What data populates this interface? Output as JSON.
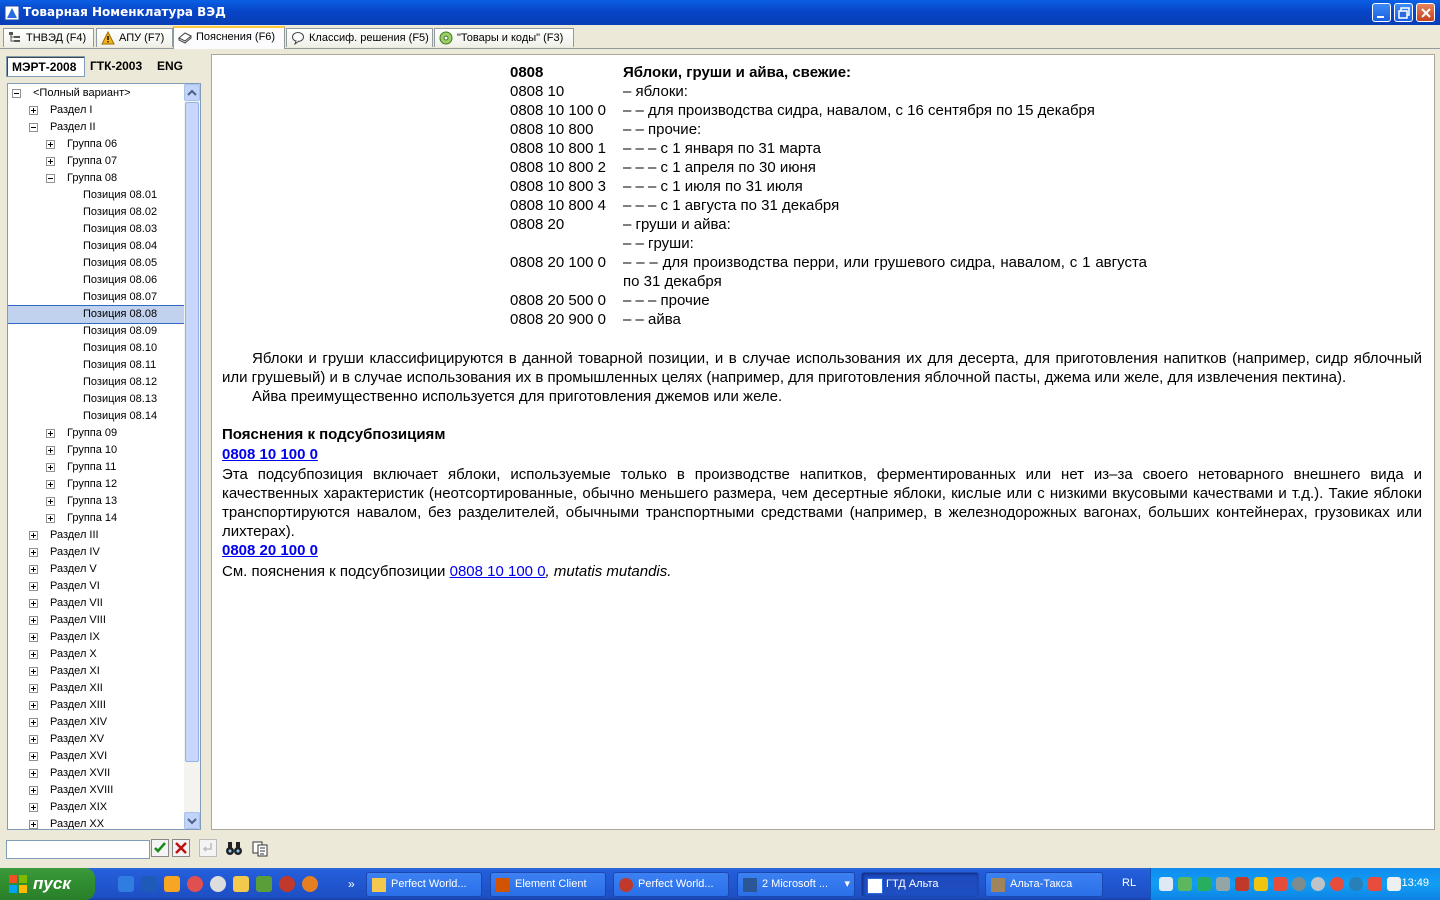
{
  "window": {
    "title": "Товарная Номенклатура ВЭД"
  },
  "tabs": [
    {
      "label": "ТНВЭД (F4)"
    },
    {
      "label": "АПУ (F7)"
    },
    {
      "label": "Пояснения (F6)"
    },
    {
      "label": "Классиф. решения (F5)"
    },
    {
      "label": "\"Товары и коды\" (F3)"
    }
  ],
  "lang_buttons": [
    "МЭРТ-2008",
    "ГТК-2003",
    "ENG"
  ],
  "tree": {
    "items": [
      "<Полный вариант>",
      "Раздел I",
      "Раздел II",
      "Группа 06",
      "Группа 07",
      "Группа 08",
      "Позиция 08.01",
      "Позиция 08.02",
      "Позиция 08.03",
      "Позиция 08.04",
      "Позиция 08.05",
      "Позиция 08.06",
      "Позиция 08.07",
      "Позиция 08.08",
      "Позиция 08.09",
      "Позиция 08.10",
      "Позиция 08.11",
      "Позиция 08.12",
      "Позиция 08.13",
      "Позиция 08.14",
      "Группа 09",
      "Группа 10",
      "Группа 11",
      "Группа 12",
      "Группа 13",
      "Группа 14",
      "Раздел III",
      "Раздел IV",
      "Раздел V",
      "Раздел VI",
      "Раздел VII",
      "Раздел VIII",
      "Раздел IX",
      "Раздел X",
      "Раздел XI",
      "Раздел XII",
      "Раздел XIII",
      "Раздел XIV",
      "Раздел XV",
      "Раздел XVI",
      "Раздел XVII",
      "Раздел XVIII",
      "Раздел XIX",
      "Раздел XX"
    ],
    "selected": "Позиция 08.08"
  },
  "content": {
    "codes": [
      {
        "code": "0808",
        "desc": "Яблоки, груши и айва, свежие:"
      },
      {
        "code": "0808 10",
        "desc": "– яблоки:"
      },
      {
        "code": "0808 10 100 0",
        "desc": "– – для производства сидра, навалом, с 16 сентября по 15 декабря"
      },
      {
        "code": "0808 10 800",
        "desc": "– – прочие:"
      },
      {
        "code": "0808 10 800 1",
        "desc": "– – – с 1 января по 31 марта"
      },
      {
        "code": "0808 10 800 2",
        "desc": "– – – с 1 апреля по 30 июня"
      },
      {
        "code": "0808 10 800 3",
        "desc": "– – – с 1 июля по 31 июля"
      },
      {
        "code": "0808 10 800 4",
        "desc": "– – – с 1 августа по 31 декабря"
      },
      {
        "code": "0808 20",
        "desc": "– груши и айва:"
      },
      {
        "code": "",
        "desc": "– – груши:"
      },
      {
        "code": "0808 20 100 0",
        "desc": "– – – для производства перри, или грушевого сидра, навалом, с 1 августа по 31 декабря"
      },
      {
        "code": "0808 20 500 0",
        "desc": "– – – прочие"
      },
      {
        "code": "0808 20 900 0",
        "desc": "– – айва"
      }
    ],
    "para1": "Яблоки и груши классифицируются в данной товарной позиции, и в случае использования их для десерта, для приготовления напитков (например, сидр яблочный или грушевый) и в случае использования их в промышленных целях (например, для приготовления яблочной пасты, джема или желе, для извлечения пектина).",
    "para2": "Айва преимущественно используется для приготовления джемов или желе.",
    "sub_heading": "Пояснения к подсубпозициям",
    "link1": "0808 10 100 0",
    "sub1_text": "Эта подсубпозиция включает яблоки, используемые только в производстве напитков, ферментированных или нет из–за своего нетоварного внешнего вида и качественных характеристик (неотсортированные, обычно меньшего размера, чем десертные яблоки, кислые или с низкими вкусовыми качествами и т.д.). Такие яблоки транспортируются навалом, без разделителей, обычными транспортными средствами (например, в железнодорожных вагонах, больших контейнерах, грузовиках или лихтерах).",
    "link2": "0808 20 100 0",
    "sub2_prefix": "См. пояснения к подсубпозиции",
    "sub2_link": "0808 10 100 0",
    "sub2_suffix": ", mutatis mutandis."
  },
  "taskbar": {
    "start": "пуск",
    "tasks": [
      "Perfect World...",
      "Element Client",
      "Perfect World...",
      "2 Microsoft ...",
      "ГТД Альта",
      "Альта-Такса"
    ],
    "lang": "RL",
    "clock": "13:49"
  }
}
